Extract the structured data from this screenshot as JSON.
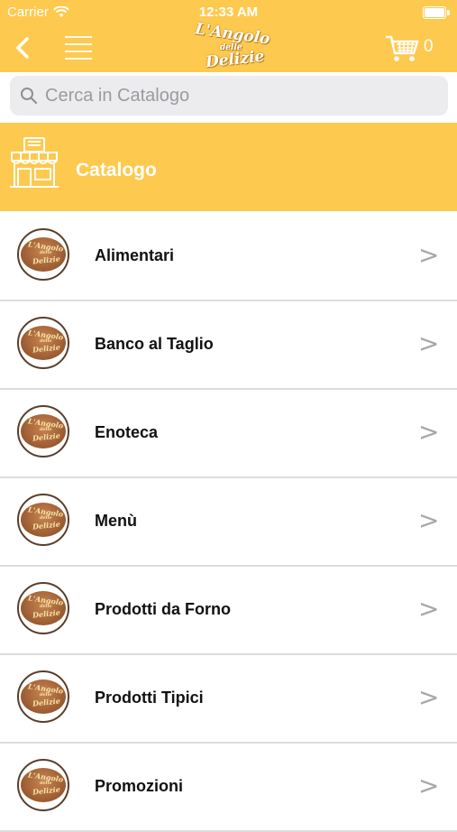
{
  "status_bar": {
    "carrier": "Carrier",
    "time": "12:33 AM"
  },
  "nav": {
    "logo_line1": "L'Angolo",
    "logo_line2": "delle",
    "logo_line3": "Delizie",
    "cart_count": "0"
  },
  "search": {
    "placeholder": "Cerca in Catalogo",
    "value": ""
  },
  "header": {
    "title": "Catalogo"
  },
  "categories": [
    {
      "label": "Alimentari"
    },
    {
      "label": "Banco al Taglio"
    },
    {
      "label": "Enoteca"
    },
    {
      "label": "Menù"
    },
    {
      "label": "Prodotti da Forno"
    },
    {
      "label": "Prodotti Tipici"
    },
    {
      "label": "Promozioni"
    }
  ],
  "row_chevron": ">",
  "thumb_logo": {
    "line1": "L'Angolo",
    "line2": "delle",
    "line3": "Delizie"
  },
  "colors": {
    "brand_yellow": "#fec94f",
    "text_white": "#ffffff",
    "chevron_gray": "#a8a8a8"
  },
  "icons": [
    "wifi-icon",
    "battery-icon",
    "back-icon",
    "menu-icon",
    "cart-icon",
    "search-icon",
    "shop-icon"
  ]
}
